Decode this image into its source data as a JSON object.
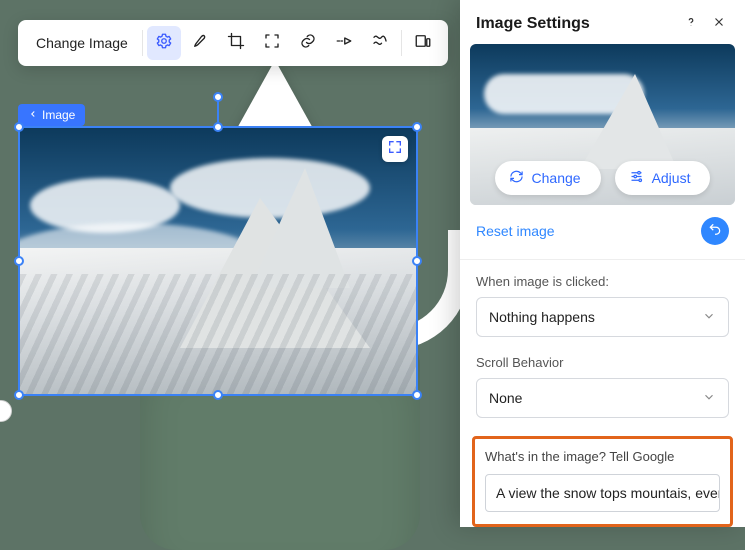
{
  "toolbar": {
    "change_image": "Change Image",
    "icons": [
      "gear-icon",
      "brush-icon",
      "crop-icon",
      "focus-icon",
      "link-icon",
      "animation-icon",
      "behavior-icon",
      "layout-icon"
    ]
  },
  "breadcrumb": {
    "label": "Image"
  },
  "panel": {
    "title": "Image Settings",
    "change_btn": "Change",
    "adjust_btn": "Adjust",
    "reset_link": "Reset image",
    "click_section_label": "When image is clicked:",
    "click_value": "Nothing happens",
    "scroll_section_label": "Scroll Behavior",
    "scroll_value": "None",
    "alt_label": "What's in the image? Tell Google",
    "alt_value": "A view the snow tops mountais, ever…"
  }
}
